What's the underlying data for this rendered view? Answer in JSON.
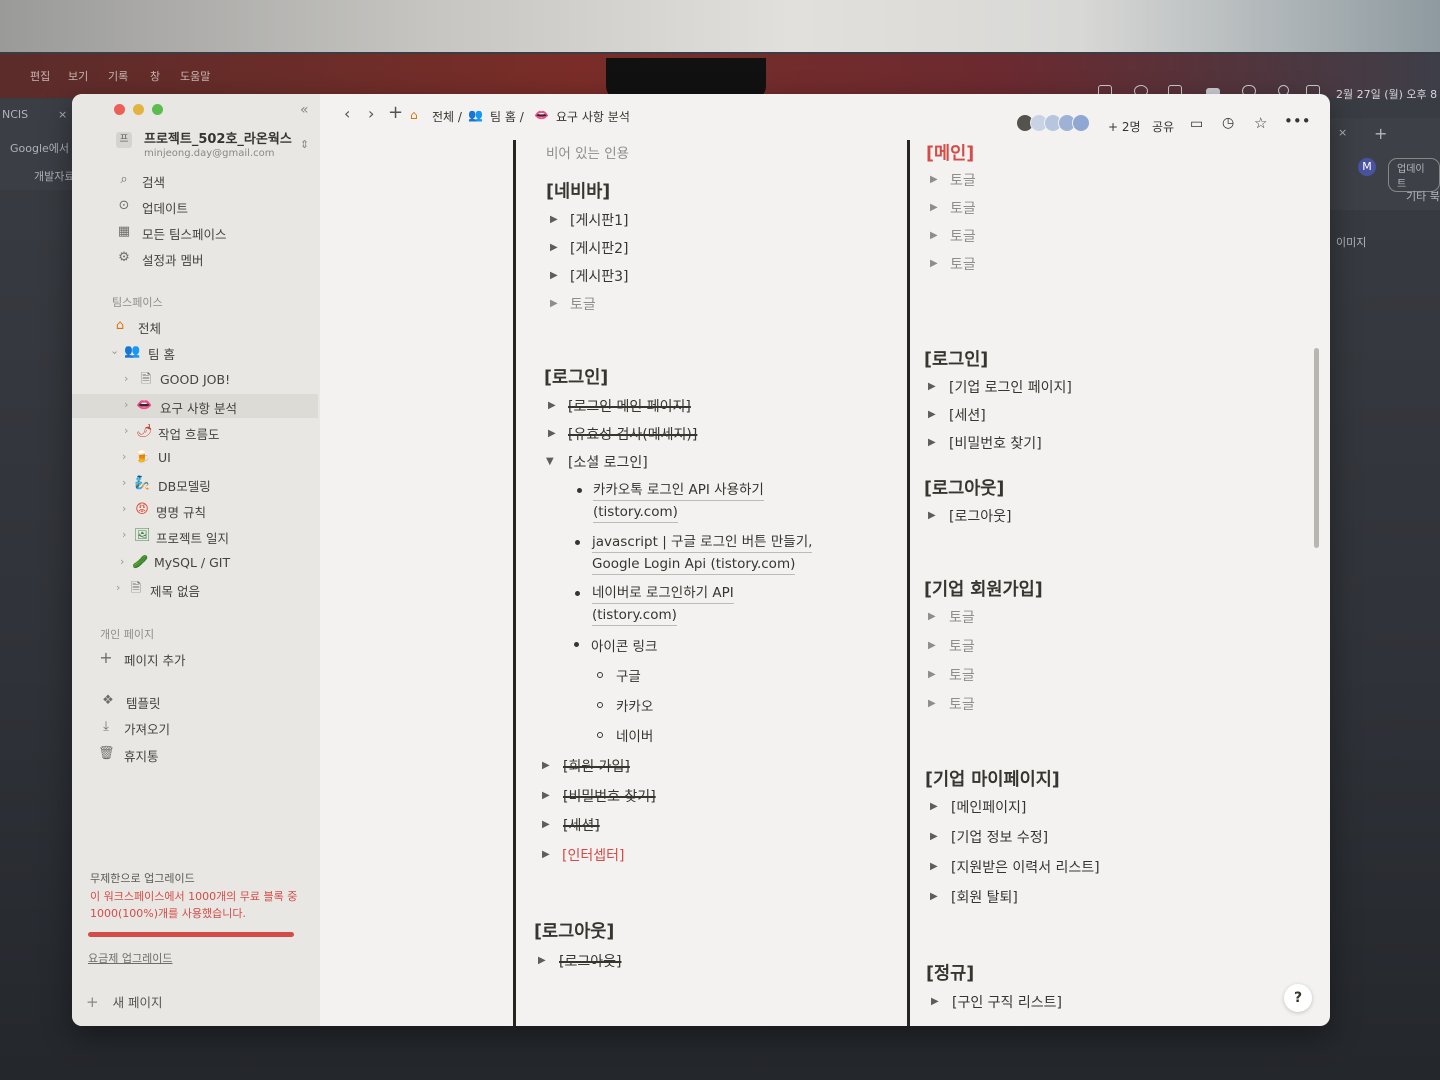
{
  "menubar": {
    "items": [
      "",
      "편집",
      "보기",
      "기록",
      "창",
      "도움말"
    ],
    "clock": "2월 27일 (월) 오후 8"
  },
  "bg_left": {
    "tab1": "NCIS",
    "tab1_close": "×",
    "tab2": "Google에서 검색",
    "bookmark": "개발자료"
  },
  "bg_right": {
    "update": "업데이트",
    "folder": "기타 북",
    "images": "이미지",
    "avatar": "M",
    "close": "×",
    "plus": "+"
  },
  "sidebar": {
    "workspace_name": "프로젝트_502호_라온웍스",
    "workspace_email": "minjeong.day@gmail.com",
    "workspace_icon": "프",
    "top_items": [
      {
        "icon": "⌕",
        "label": "검색"
      },
      {
        "icon": "⊙",
        "label": "업데이트"
      },
      {
        "icon": "▦",
        "label": "모든 팀스페이스"
      },
      {
        "icon": "⚙",
        "label": "설정과 멤버"
      }
    ],
    "section_teamspace": "팀스페이스",
    "team_all": "전체",
    "team_home": "팀 홈",
    "pages": [
      {
        "icon": "🗎",
        "label": "GOOD JOB!"
      },
      {
        "icon": "👄",
        "label": "요구 사항 분석"
      },
      {
        "icon": "🌶",
        "label": "작업 흐름도"
      },
      {
        "icon": "🍺",
        "label": "UI"
      },
      {
        "icon": "🧞",
        "label": "DB모델링"
      },
      {
        "icon": "😡",
        "label": "명명 규칙"
      },
      {
        "icon": "🖼",
        "label": "프로젝트 일지"
      },
      {
        "icon": "🥒",
        "label": "MySQL / GIT"
      },
      {
        "icon": "🗎",
        "label": "제목 없음"
      }
    ],
    "section_private": "개인 페이지",
    "add_page": "페이지 추가",
    "bottom_items": [
      {
        "icon": "❖",
        "label": "템플릿"
      },
      {
        "icon": "⤓",
        "label": "가져오기"
      },
      {
        "icon": "🗑",
        "label": "휴지통"
      }
    ],
    "upgrade_title": "무제한으로 업그레이드",
    "upgrade_warning": "이 워크스페이스에서 1000개의 무료 블록 중 1000(100%)개를 사용했습니다.",
    "upgrade_usage_fraction": 1.0,
    "upgrade_link": "요금제 업그레이드",
    "new_page": "새 페이지"
  },
  "topbar": {
    "crumb_all": "전체 /",
    "crumb_home": "팀 홈 /",
    "crumb_current": "요구 사항 분석",
    "more_people": "+ 2명",
    "share": "공유"
  },
  "col1": {
    "empty_quote": "비어 있는 인용",
    "navbar_title": "[네비바]",
    "navbar_items": [
      "[게시판1]",
      "[게시판2]",
      "[게시판3]"
    ],
    "navbar_toggle": "토글",
    "login_title": "[로그인]",
    "login_main": "[로그인 메인 페이지]",
    "login_valid": "[유효성 검사(메세지)]",
    "login_social": "[소셜 로그인]",
    "links": [
      {
        "line1": "카카오톡 로그인 API 사용하기",
        "line2": "(tistory.com)"
      },
      {
        "line1": "javascript | 구글 로그인 버튼 만들기,",
        "line2": "Google Login Api (tistory.com)"
      },
      {
        "line1": "네이버로 로그인하기 API",
        "line2": "(tistory.com)"
      }
    ],
    "icon_link": "아이콘 링크",
    "icon_sub": [
      "구글",
      "카카오",
      "네이버"
    ],
    "signup": "[회원 가입]",
    "find_pw": "[비밀번호 찾기]",
    "session": "[세션]",
    "interceptor": "[인터셉터]",
    "logout_title": "[로그아웃]",
    "logout_item": "[로그아웃]"
  },
  "col2": {
    "main_title": "[메인]",
    "main_toggles": [
      "토글",
      "토글",
      "토글",
      "토글"
    ],
    "login_title": "[로그인]",
    "login_items": [
      "[기업 로그인 페이지]",
      "[세션]",
      "[비밀번호 찾기]"
    ],
    "logout_title": "[로그아웃]",
    "logout_item": "[로그아웃]",
    "corp_signup_title": "[기업 회원가입]",
    "corp_signup_toggles": [
      "토글",
      "토글",
      "토글",
      "토글"
    ],
    "corp_my_title": "[기업 마이페이지]",
    "corp_my_items": [
      "[메인페이지]",
      "[기업 정보 수정]",
      "[지원받은 이력서 리스트]",
      "[회원 탈퇴]"
    ],
    "regular_title": "[정규]",
    "regular_items": [
      "[구인 구직 리스트]"
    ]
  },
  "help": "?",
  "colors": {
    "red": "#d44c47",
    "text": "#37352f",
    "sidebar": "#e9e7e3",
    "page": "#f3f2f0"
  }
}
